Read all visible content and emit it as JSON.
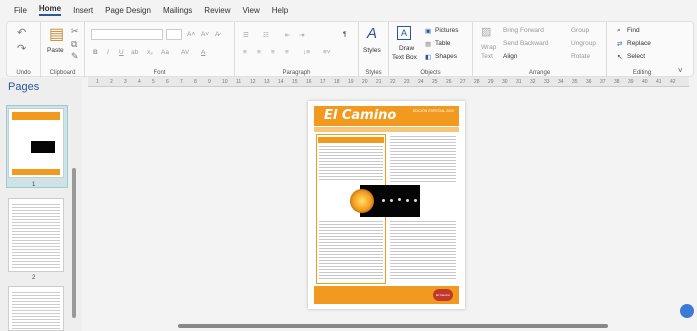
{
  "menu": [
    "File",
    "Home",
    "Insert",
    "Page Design",
    "Mailings",
    "Review",
    "View",
    "Help"
  ],
  "ribbon": {
    "undo": {
      "label": "Undo"
    },
    "clipboard": {
      "label": "Clipboard",
      "paste": "Paste"
    },
    "font": {
      "label": "Font",
      "font_name": "",
      "font_size": ""
    },
    "paragraph": {
      "label": "Paragraph"
    },
    "styles": {
      "label": "Styles",
      "button": "Styles"
    },
    "objects": {
      "label": "Objects",
      "draw": "Draw",
      "textbox": "Text Box",
      "pictures": "Pictures",
      "table": "Table",
      "shapes": "Shapes"
    },
    "arrange": {
      "label": "Arrange",
      "wrap": "Wrap",
      "text": "Text",
      "bring_forward": "Bring Forward",
      "send_backward": "Send Backward",
      "align": "Align",
      "group": "Group",
      "ungroup": "Ungroup",
      "rotate": "Rotate"
    },
    "editing": {
      "label": "Editing",
      "find": "Find",
      "replace": "Replace",
      "select": "Select"
    }
  },
  "pages": {
    "title": "Pages",
    "items": [
      {
        "num": "1"
      },
      {
        "num": "2"
      }
    ]
  },
  "document": {
    "masthead": "El Camino",
    "subhead": "EDICIÓN ESPECIAL 2020",
    "footer_badge": "El Camino"
  },
  "ruler": [
    "1",
    "2",
    "3",
    "4",
    "5",
    "6",
    "7",
    "8",
    "9",
    "10",
    "11",
    "12",
    "13",
    "14",
    "15",
    "16",
    "17",
    "18",
    "19",
    "20",
    "21",
    "22",
    "23",
    "24",
    "25",
    "26",
    "27",
    "28",
    "29",
    "30",
    "31",
    "32",
    "33",
    "34",
    "35",
    "36",
    "37",
    "38",
    "39",
    "40",
    "41",
    "42"
  ]
}
